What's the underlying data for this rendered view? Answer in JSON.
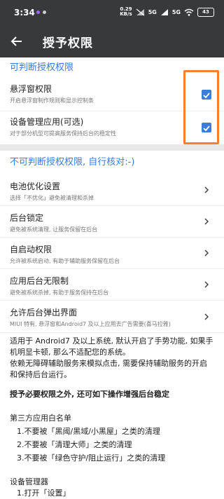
{
  "status_bar": {
    "time": "3:34",
    "net_speed_top": "0.29",
    "net_speed_bottom": "KB/s",
    "signal_1": "5G",
    "signal_2": "5G",
    "battery": "43"
  },
  "app_bar": {
    "title": "授予权限",
    "back_icon": "arrow-left-icon"
  },
  "section_judgeable": {
    "header": "可判断授权权限",
    "items": [
      {
        "title": "悬浮窗权限",
        "subtitle": "开启悬浮窗制作规则和显示控制条",
        "checked": true
      },
      {
        "title": "设备管理应用(可选)",
        "subtitle": "对于部分机型可提高服务保持后台的稳定性",
        "checked": true
      }
    ]
  },
  "section_unjudgeable": {
    "header": "不可判断授权权限, 自行核对:-)",
    "items": [
      {
        "title": "电池优化设置",
        "subtitle": "选择「不优化」避免被清理和杀掉"
      },
      {
        "title": "后台锁定",
        "subtitle": "避免被系统清理, 让服务保留在后台"
      },
      {
        "title": "自启动权限",
        "subtitle": "允许被系统启动, 有助于辅助服务保留在后台"
      },
      {
        "title": "应用后台无限制",
        "subtitle": "避免被系统杀掉, 有助于服务保持在后台"
      },
      {
        "title": "允许后台弹出界面",
        "subtitle": "MIUI 特有, 悬浮窗和Android7 及以上应用去广告需要(喜马拉雅)"
      }
    ]
  },
  "notes": {
    "para1": "适用于 Android7 及以上系统, 默认开启了手势功能, 如果手机明显卡顿, 那么不适配您的系统。",
    "para2": "依赖无障碍辅助服务来模拟点击, 需要保持辅助服务的开启和保持后台运行。",
    "para3": "授予必要权限之外, 还可如下操作增强后台稳定",
    "whitelist_title": "第三方应用白名单",
    "whitelist_items": [
      "1.不要被「黑阈/黑域/小黑屋」之类的清理",
      "2.不要被「清理大师」之类的清理",
      "3.不要被「绿色守护/阻止运行」之类的清理"
    ],
    "device_admin_title": "设备管理器",
    "device_admin_first": "1.打开「设置」"
  },
  "colors": {
    "accent": "#3b7dd8",
    "highlight": "#f57f32",
    "bar": "#37393b"
  }
}
